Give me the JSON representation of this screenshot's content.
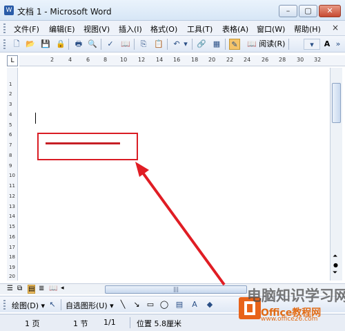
{
  "window": {
    "title": "文档 1 - Microsoft Word",
    "app_icon": "W"
  },
  "menu": [
    {
      "label": "文件(F)"
    },
    {
      "label": "编辑(E)"
    },
    {
      "label": "视图(V)"
    },
    {
      "label": "插入(I)"
    },
    {
      "label": "格式(O)"
    },
    {
      "label": "工具(T)"
    },
    {
      "label": "表格(A)"
    },
    {
      "label": "窗口(W)"
    },
    {
      "label": "帮助(H)"
    }
  ],
  "menu_close": "×",
  "toolbar": {
    "read_label": "阅读(R)",
    "font_size_icon": "A"
  },
  "ruler": {
    "h_numbers": [
      "2",
      "4",
      "6",
      "8",
      "10",
      "12",
      "14",
      "16",
      "18",
      "20",
      "22",
      "24",
      "26",
      "28",
      "30",
      "32"
    ],
    "v_numbers": [
      "1",
      "2",
      "3",
      "4",
      "5",
      "6",
      "7",
      "8",
      "9",
      "10",
      "11",
      "12",
      "13",
      "14",
      "15",
      "16",
      "17",
      "18",
      "19",
      "20"
    ],
    "corner": "L"
  },
  "drawbar": {
    "draw_label": "绘图(D) ▾",
    "autoshape_label": "自选图形(U) ▾"
  },
  "status": {
    "page": "1 页",
    "section": "1 节",
    "page_of": "1/1",
    "position": "位置 5.8厘米"
  },
  "watermark": {
    "cn": "电脑知识学习网",
    "office": "Office教程网",
    "url": "www.office26.com"
  },
  "colors": {
    "annotation_red": "#d91c24"
  }
}
